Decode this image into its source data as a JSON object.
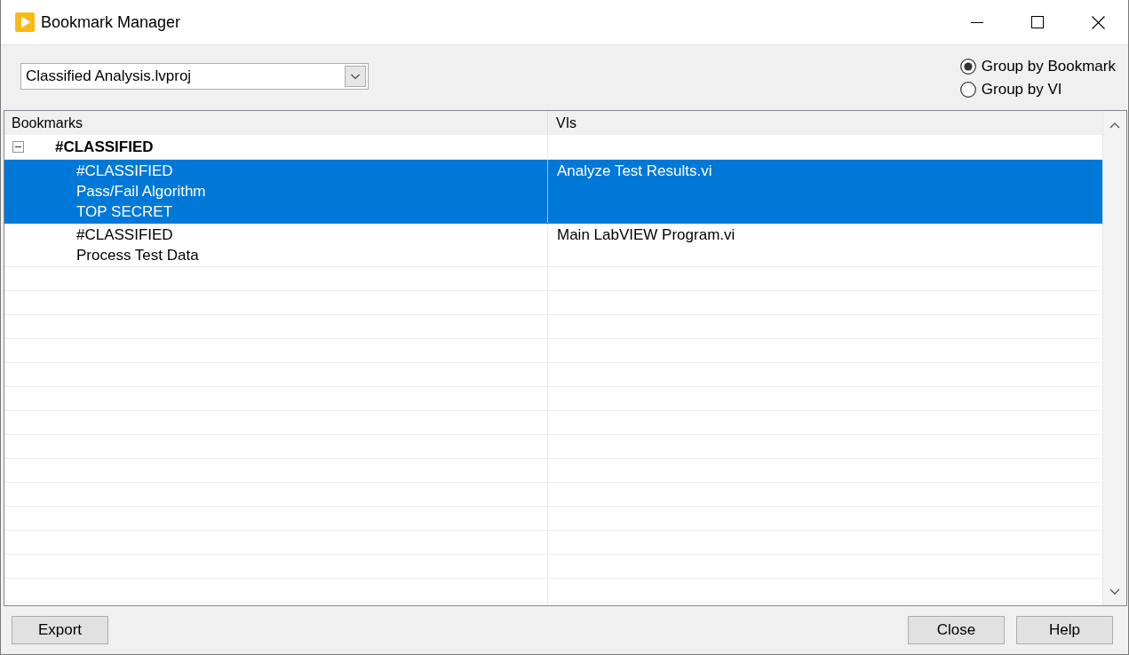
{
  "window": {
    "title": "Bookmark Manager"
  },
  "project_dropdown": {
    "value": "Classified Analysis.lvproj"
  },
  "group_by": [
    {
      "label": "Group by Bookmark",
      "selected": true
    },
    {
      "label": "Group by VI",
      "selected": false
    }
  ],
  "table": {
    "columns": [
      "Bookmarks",
      "VIs"
    ],
    "groups": [
      {
        "label": "#CLASSIFIED",
        "expanded": true,
        "children": [
          {
            "bookmark": [
              "#CLASSIFIED",
              "Pass/Fail Algorithm",
              "TOP SECRET"
            ],
            "vi": "Analyze Test Results.vi",
            "selected": true
          },
          {
            "bookmark": [
              "#CLASSIFIED",
              "Process Test Data"
            ],
            "vi": "Main LabVIEW Program.vi",
            "selected": false
          }
        ]
      }
    ]
  },
  "footer": {
    "left_buttons": [
      "Export"
    ],
    "right_buttons": [
      "Close",
      "Help"
    ]
  }
}
